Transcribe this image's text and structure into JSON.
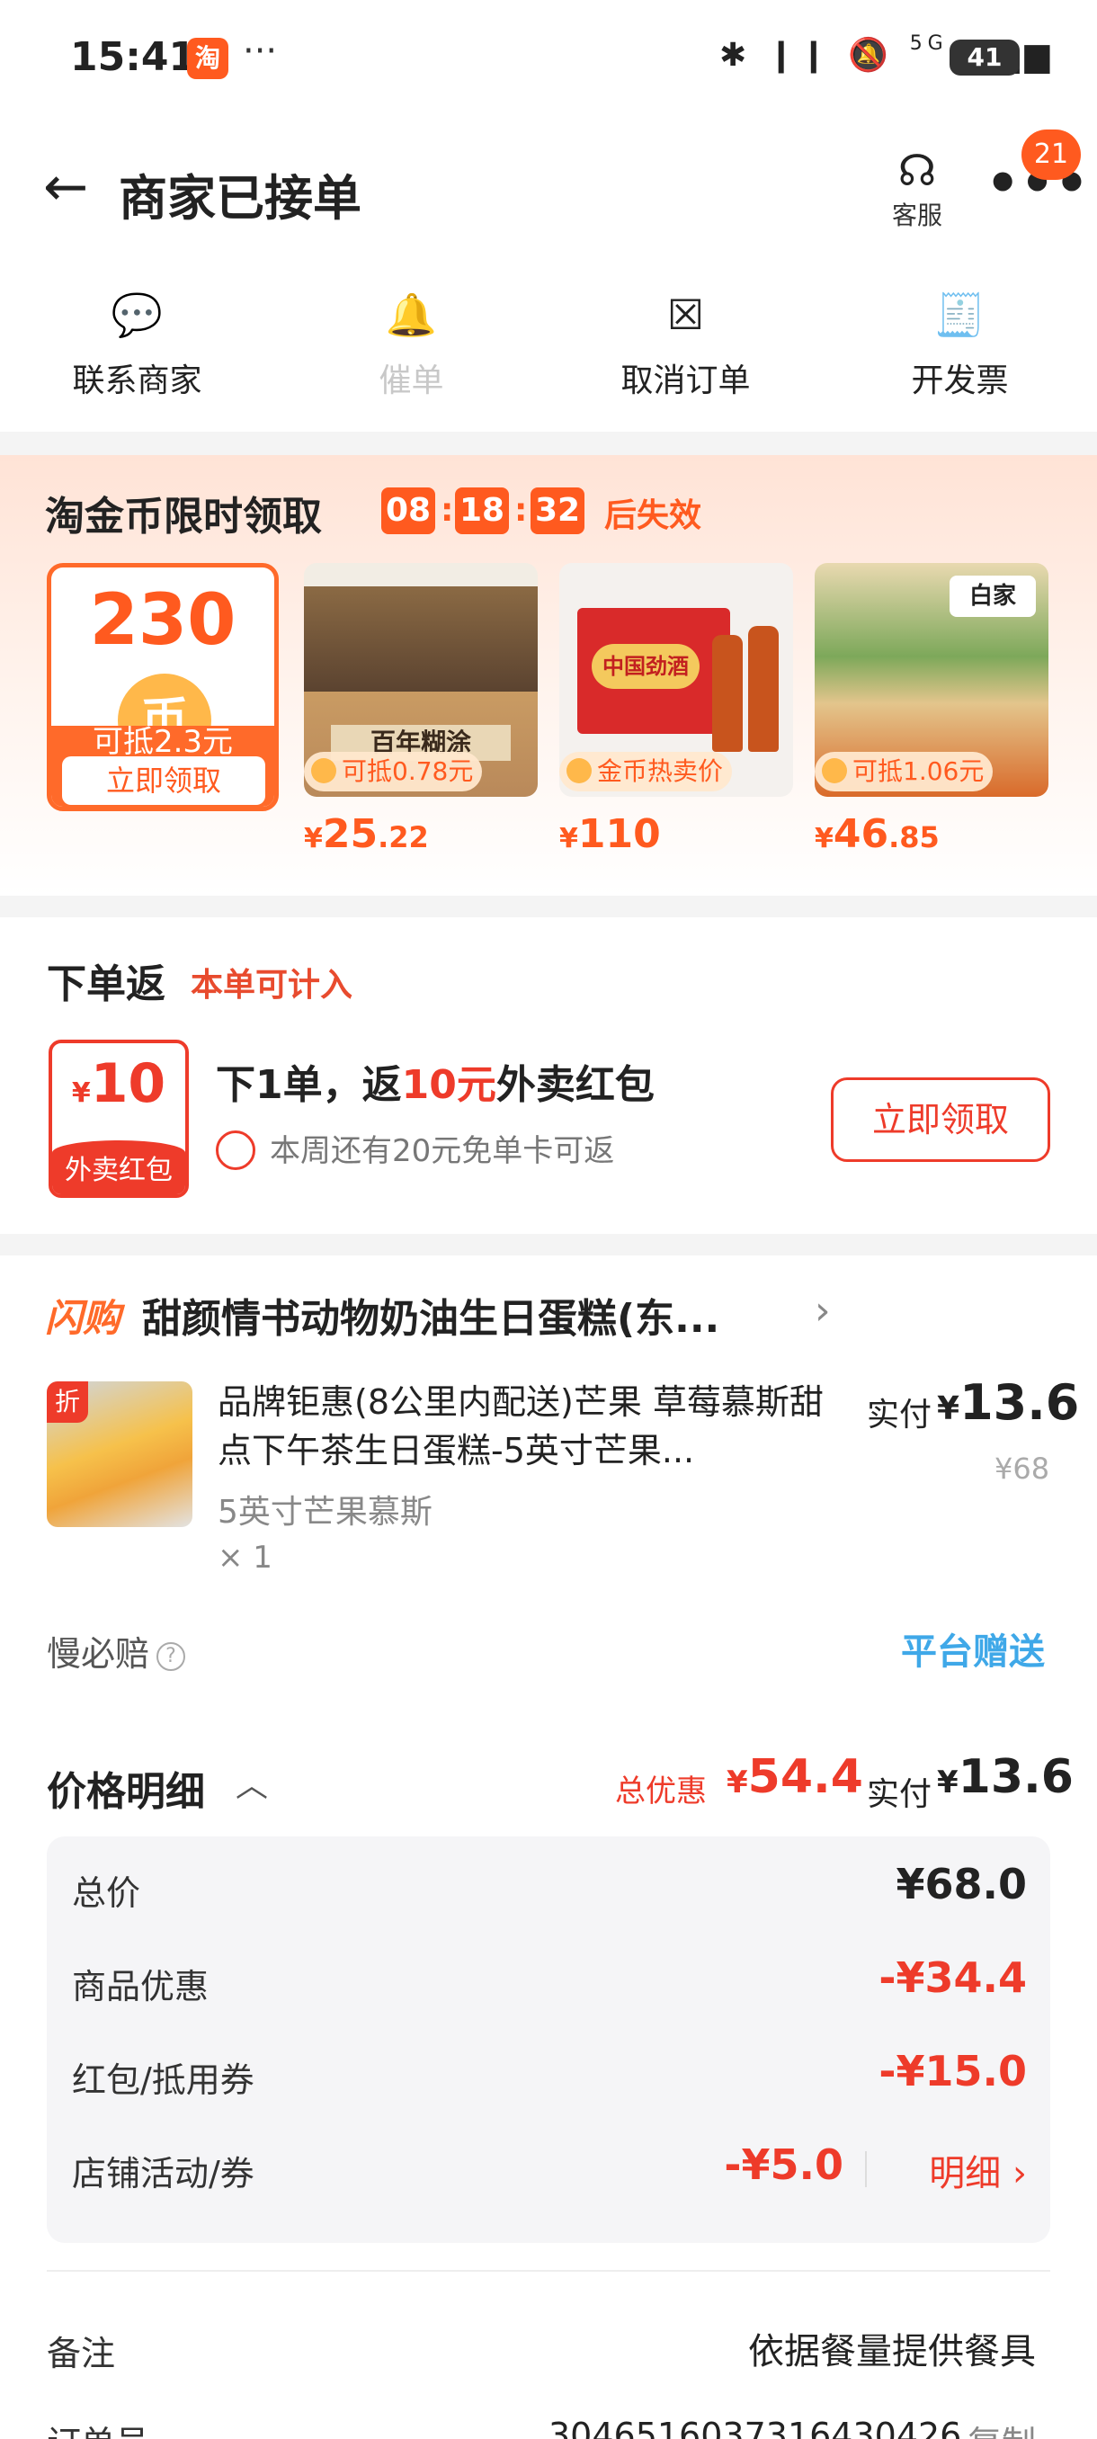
{
  "status": {
    "time": "15:41",
    "app_icon": "淘",
    "dots": "···",
    "network": "5G",
    "battery": "41"
  },
  "header": {
    "title": "商家已接单",
    "service_label": "客服",
    "badge": "21"
  },
  "actions": [
    {
      "label": "联系商家",
      "icon": "chat-icon"
    },
    {
      "label": "催单",
      "icon": "bell-icon"
    },
    {
      "label": "取消订单",
      "icon": "cancel-doc-icon"
    },
    {
      "label": "开发票",
      "icon": "invoice-icon"
    }
  ],
  "coin": {
    "title": "淘金币限时领取",
    "timer": {
      "h": "08",
      "m": "18",
      "s": "32"
    },
    "expire": "后失效",
    "card": {
      "amount": "230",
      "coin_glyph": "币",
      "deduct": "可抵2.3元",
      "button": "立即领取"
    },
    "products": [
      {
        "tag": "可抵0.78元",
        "price_int": "25",
        "price_dec": ".22",
        "name": "百年糊涂"
      },
      {
        "tag": "金币热卖价",
        "price_int": "110",
        "price_dec": "",
        "name": "中国劲酒"
      },
      {
        "tag": "可抵1.06元",
        "price_int": "46",
        "price_dec": ".85",
        "name": "白家"
      }
    ],
    "currency": "¥"
  },
  "rebate": {
    "title": "下单返",
    "subtitle": "本单可计入",
    "envelope_amount": "10",
    "envelope_label": "外卖红包",
    "line1_a": "下1单，返",
    "line1_hl": "10元",
    "line1_b": "外卖红包",
    "line2": "本周还有20元免单卡可返",
    "button": "立即领取"
  },
  "order": {
    "flash_label": "闪购",
    "shop": "甜颜情书动物奶油生日蛋糕(东...",
    "discount_tag": "折",
    "product_name": "品牌钜惠(8公里内配送)芒果 草莓慕斯甜点下午茶生日蛋糕-5英寸芒果...",
    "spec": "5英寸芒果慕斯",
    "qty": "× 1",
    "paid_label": "实付",
    "paid_value": "13.6",
    "original": "¥68",
    "slow_label": "慢必赔",
    "gift_label": "平台赠送",
    "price_header": "价格明细",
    "total_discount_label": "总优惠",
    "total_discount_value": "54.4",
    "paid2_label": "实付",
    "paid2_value": "13.6",
    "rows": [
      {
        "k": "总价",
        "v": "¥68.0"
      },
      {
        "k": "商品优惠",
        "v": "-¥34.4"
      },
      {
        "k": "红包/抵用券",
        "v": "-¥15.0"
      },
      {
        "k": "店铺活动/券",
        "v": "-¥5.0",
        "detail": "明细"
      }
    ],
    "remark_label": "备注",
    "remark_value": "依据餐量提供餐具",
    "order_no_label": "订单号",
    "order_no_value": "3046516037316430426",
    "copy": "复制"
  }
}
